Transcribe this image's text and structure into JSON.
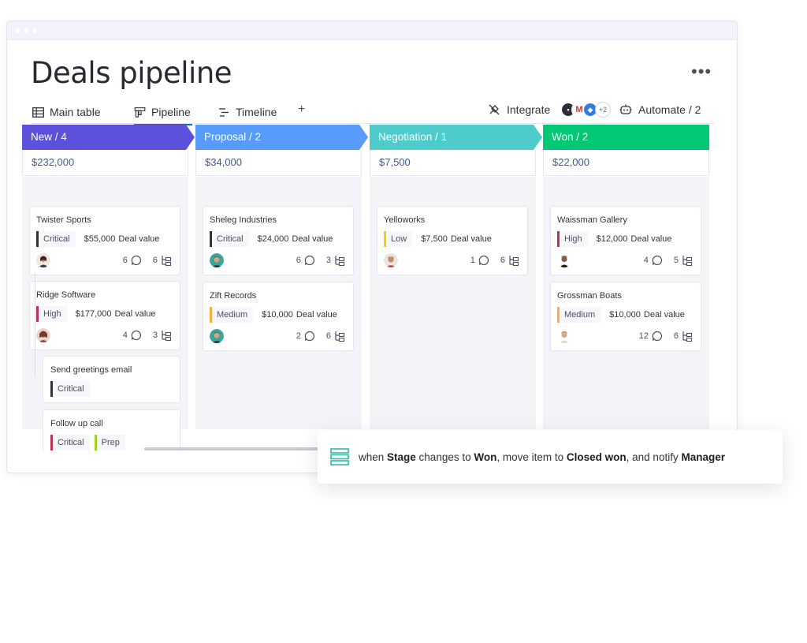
{
  "page": {
    "title": "Deals pipeline",
    "more_label": "•••"
  },
  "views": {
    "tabs": [
      {
        "label": "Main table",
        "icon": "table-icon"
      },
      {
        "label": "Pipeline",
        "icon": "kanban-icon",
        "active": true
      },
      {
        "label": "Timeline",
        "icon": "timeline-icon"
      }
    ],
    "add_label": "+",
    "integrate_label": "Integrate",
    "integrations_more": "+2",
    "automate_label": "Automate / 2"
  },
  "colors": {
    "new": "#5b51dd",
    "proposal": "#579bfc",
    "negotiation": "#4ecccc",
    "won": "#00c875",
    "critical": "#333333",
    "high": "#bb3354",
    "medium": "#fdab3d",
    "low": "#ffcb00",
    "prep": "#9cd326",
    "accent": "#0073ea"
  },
  "columns": [
    {
      "name": "New / 4",
      "total": "$232,000",
      "cards": [
        {
          "title": "Twister Sports",
          "priority": "Critical",
          "amount": "$55,000",
          "amount_label": "Deal value",
          "comments": "6",
          "subitems": "6"
        },
        {
          "title": "Ridge Software",
          "priority": "High",
          "amount": "$177,000",
          "amount_label": "Deal value",
          "comments": "4",
          "subitems": "3"
        }
      ],
      "subitems": [
        {
          "title": "Send greetings email",
          "tags": [
            "Critical"
          ]
        },
        {
          "title": "Follow up call",
          "tags": [
            "Critical",
            "Prep"
          ]
        }
      ]
    },
    {
      "name": "Proposal / 2",
      "total": "$34,000",
      "cards": [
        {
          "title": "Sheleg Industries",
          "priority": "Critical",
          "amount": "$24,000",
          "amount_label": "Deal value",
          "comments": "6",
          "subitems": "3"
        },
        {
          "title": "Zift Records",
          "priority": "Medium",
          "amount": "$10,000",
          "amount_label": "Deal value",
          "comments": "2",
          "subitems": "6"
        }
      ]
    },
    {
      "name": "Negotiation / 1",
      "total": "$7,500",
      "cards": [
        {
          "title": "Yelloworks",
          "priority": "Low",
          "amount": "$7,500",
          "amount_label": "Deal value",
          "comments": "1",
          "subitems": "6"
        }
      ]
    },
    {
      "name": "Won / 2",
      "total": "$22,000",
      "cards": [
        {
          "title": "Waissman Gallery",
          "priority": "High",
          "amount": "$12,000",
          "amount_label": "Deal value",
          "comments": "4",
          "subitems": "5"
        },
        {
          "title": "Grossman Boats",
          "priority": "Medium",
          "amount": "$10,000",
          "amount_label": "Deal value",
          "comments": "12",
          "subitems": "6"
        }
      ]
    }
  ],
  "automation": {
    "icon": "automation-rows-icon",
    "parts": [
      "when ",
      "Stage",
      " changes to ",
      "Won",
      ", move item to ",
      "Closed won",
      ", and notify ",
      "Manager"
    ]
  }
}
